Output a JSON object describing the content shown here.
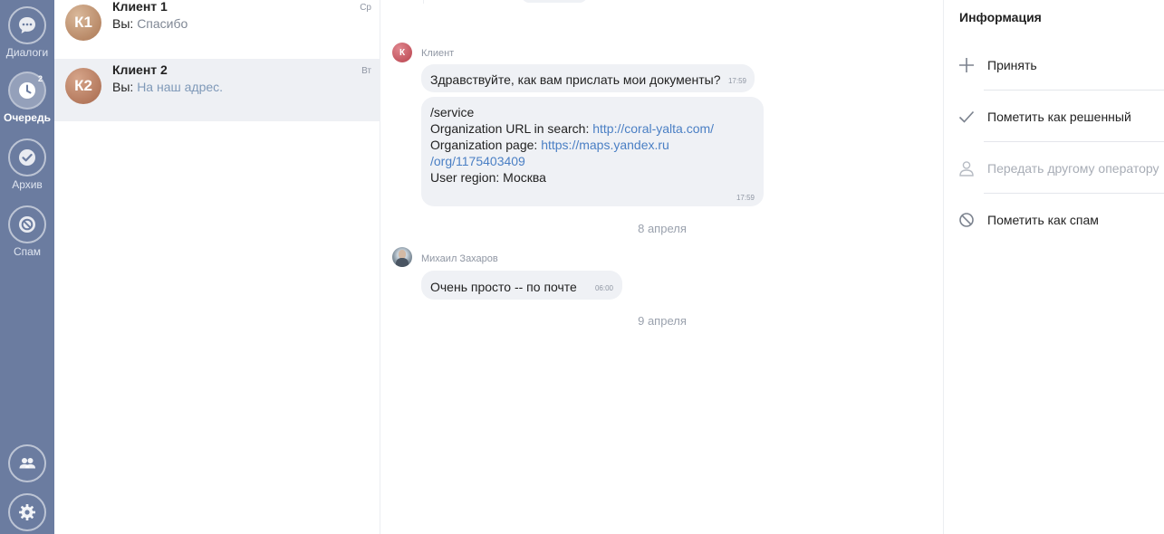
{
  "nav": {
    "items": [
      {
        "label": "Диалоги",
        "icon": "chat-bubble-icon"
      },
      {
        "label": "Очередь",
        "icon": "clock-icon",
        "badge": "2"
      },
      {
        "label": "Архив",
        "icon": "check-circle-icon"
      },
      {
        "label": "Спам",
        "icon": "ban-icon"
      }
    ],
    "bottom": [
      {
        "icon": "users-icon"
      },
      {
        "icon": "gear-icon"
      }
    ]
  },
  "conversations": [
    {
      "avatar": "К1",
      "name": "Клиент 1",
      "prefix": "Вы:",
      "preview": "Спасибо",
      "day": "Ср",
      "selected": false
    },
    {
      "avatar": "К2",
      "name": "Клиент 2",
      "prefix": "Вы:",
      "preview": "На наш адрес.",
      "day": "Вт",
      "selected": true
    }
  ],
  "chat": {
    "client_sender": {
      "name": "Клиент",
      "avatar_letter": "К"
    },
    "message1": {
      "text": "Здравствуйте, как вам прислать мои документы?",
      "time": "17:59"
    },
    "message2": {
      "line1": "/service",
      "line2_label": "Organization URL in search: ",
      "line2_link": "http://coral-yalta.com/",
      "line3_label": "Organization page: ",
      "line3_link_a": "https://maps.yandex.ru",
      "line3_link_b": "/org/1175403409",
      "line4": "User region:  Москва",
      "time": "17:59"
    },
    "date1": "8 апреля",
    "operator_sender": {
      "name": "Михаил Захаров"
    },
    "message3": {
      "text": "Очень просто -- по почте",
      "time": "06:00"
    },
    "date2": "9 апреля"
  },
  "info": {
    "title": "Информация",
    "actions": [
      {
        "label": "Принять",
        "icon": "plus-icon",
        "enabled": true
      },
      {
        "label": "Пометить как решенный",
        "icon": "check-icon",
        "enabled": true
      },
      {
        "label": "Передать другому оператору",
        "icon": "person-icon",
        "enabled": false
      },
      {
        "label": "Пометить как спам",
        "icon": "ban-icon",
        "enabled": true
      }
    ]
  }
}
